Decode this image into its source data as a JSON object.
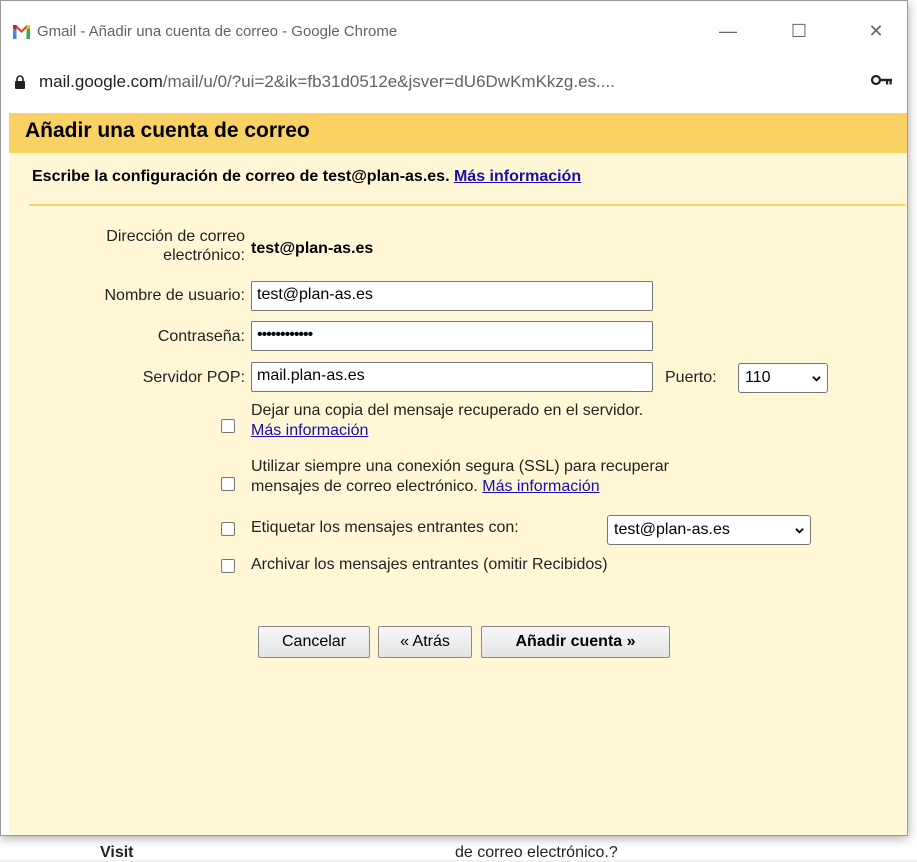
{
  "window": {
    "title": "Gmail - Añadir una cuenta de correo - Google Chrome",
    "minimize": "—",
    "maximize": "☐",
    "close": "✕"
  },
  "address": {
    "host": "mail.google.com",
    "path": "/mail/u/0/?ui=2&ik=fb31d0512e&jsver=dU6DwKmKkzg.es....",
    "key_icon": "key-icon"
  },
  "dialog": {
    "title": "Añadir una cuenta de correo",
    "intro": "Escribe la configuración de correo de test@plan-as.es.",
    "intro_link": "Más información"
  },
  "form": {
    "email_label_line1": "Dirección de correo",
    "email_label_line2": "electrónico:",
    "email_value": "test@plan-as.es",
    "username_label": "Nombre de usuario:",
    "username_value": "test@plan-as.es",
    "password_label": "Contraseña:",
    "password_value": "••••••••••••",
    "pop_label": "Servidor POP:",
    "pop_value": "mail.plan-as.es",
    "port_label": "Puerto:",
    "port_value": "110"
  },
  "options": {
    "leave_copy_text": "Dejar una copia del mensaje recuperado en el servidor.",
    "leave_copy_link": "Más información",
    "ssl_text_line1": "Utilizar siempre una conexión segura (SSL) para recuperar",
    "ssl_text_line2": "mensajes de correo electrónico.",
    "ssl_link": "Más información",
    "label_text": "Etiquetar los mensajes entrantes con:",
    "label_value": "test@plan-as.es",
    "archive_text": "Archivar los mensajes entrantes (omitir Recibidos)"
  },
  "buttons": {
    "cancel": "Cancelar",
    "back": "« Atrás",
    "add": "Añadir cuenta »"
  },
  "background": {
    "bottom_left": "Visit",
    "bottom_mid": "de correo electrónico.?"
  },
  "colors": {
    "header": "#fad163",
    "panel": "#fff7d6",
    "link": "#1a0dab"
  }
}
